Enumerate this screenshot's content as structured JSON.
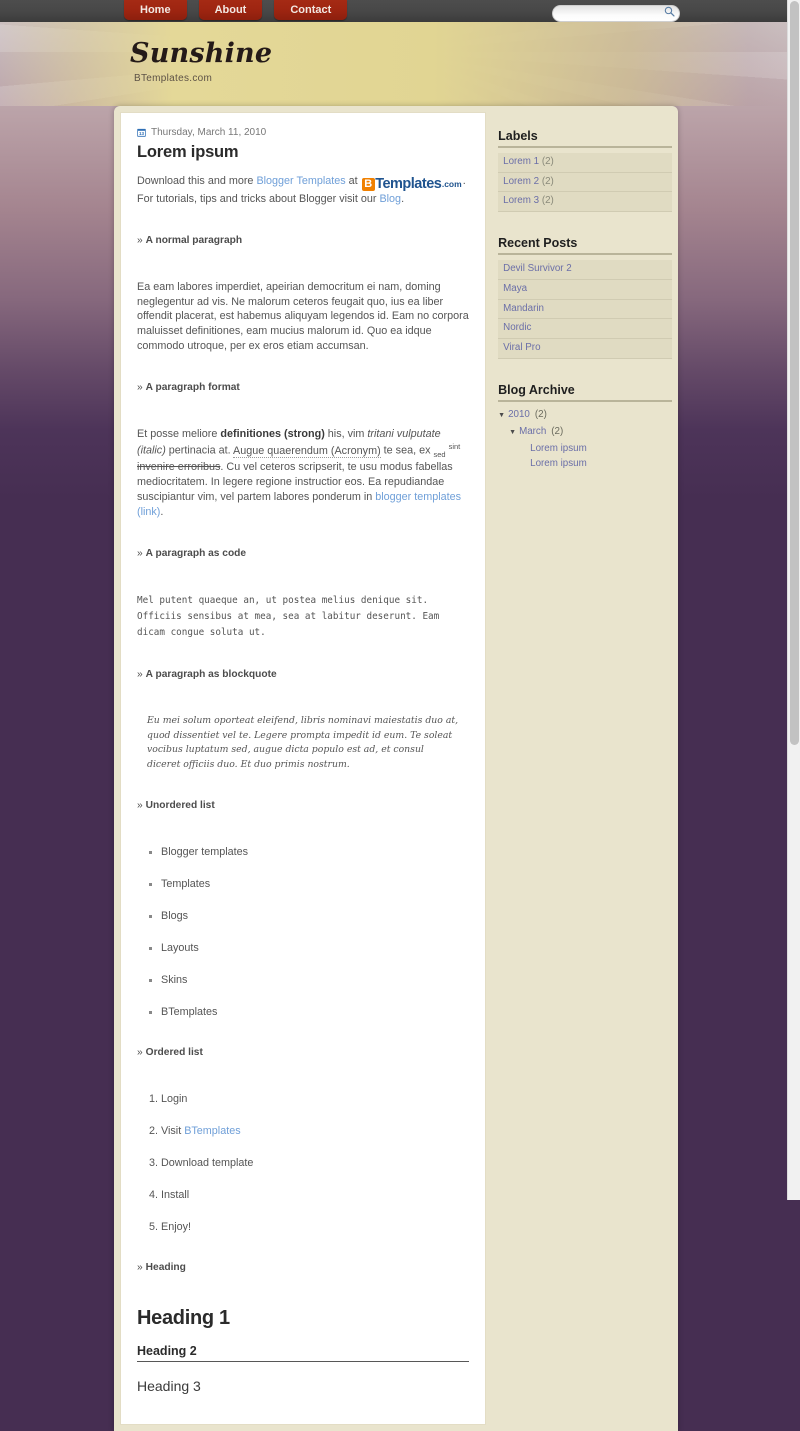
{
  "topbar": {
    "nav_items": [
      {
        "label": "Home"
      },
      {
        "label": "About"
      },
      {
        "label": "Contact"
      }
    ],
    "search": {
      "value": "",
      "placeholder": "",
      "icon": "search-icon"
    }
  },
  "header": {
    "site_title": "Sunshine",
    "site_subtitle": "BTemplates.com"
  },
  "post": {
    "date_icon": "calendar-icon",
    "date": "Thursday, March 11, 2010",
    "title": "Lorem ipsum",
    "intro": {
      "t1": "Download this and more ",
      "link1": "Blogger Templates",
      "t2": " at ",
      "logo_b": "B",
      "logo_word": "Templates",
      "logo_com": ".com",
      "t3": ". For tutorials, tips and tricks about Blogger visit our ",
      "link2": "Blog",
      "t4": "."
    },
    "sections": {
      "normal_paragraph": {
        "label": "A normal paragraph",
        "text": "Ea eam labores imperdiet, apeirian democritum ei nam, doming neglegentur ad vis. Ne malorum ceteros feugait quo, ius ea liber offendit placerat, est habemus aliquyam legendos id. Eam no corpora maluisset definitiones, eam mucius malorum id. Quo ea idque commodo utroque, per ex eros etiam accumsan."
      },
      "paragraph_format": {
        "label": "A paragraph format",
        "p1": "Et posse meliore ",
        "strong": "definitiones (strong)",
        "p2": " his, vim ",
        "italic": "tritani vulputate (italic)",
        "p3": " pertinacia at. ",
        "acronym": "Augue quaerendum (Acronym)",
        "p4": " te sea, ex ",
        "sub": "sed",
        "p5": " ",
        "sup": "sint",
        "p6": " ",
        "strike": "invenire erroribus",
        "p7": ". Cu vel ceteros scripserit, te usu modus fabellas mediocritatem. In legere regione instructior eos. Ea repudiandae suscipiantur vim, vel partem labores ponderum in ",
        "link": "blogger templates (link)",
        "p8": "."
      },
      "code": {
        "label": "A paragraph as code",
        "text": "Mel putent quaeque an, ut postea melius denique sit. Officiis sensibus at mea, sea at labitur deserunt. Eam dicam congue soluta ut."
      },
      "blockquote": {
        "label": "A paragraph as blockquote",
        "text": "Eu mei solum oporteat eleifend, libris nominavi maiestatis duo at, quod dissentiet vel te. Legere prompta impedit id eum. Te soleat vocibus luptatum sed, augue dicta populo est ad, et consul diceret officiis duo. Et duo primis nostrum."
      },
      "unordered_list": {
        "label": "Unordered list",
        "items": [
          "Blogger templates",
          "Templates",
          "Blogs",
          "Layouts",
          "Skins",
          "BTemplates"
        ]
      },
      "ordered_list": {
        "label": "Ordered list",
        "items": [
          {
            "text": "Login",
            "link": ""
          },
          {
            "text": "Visit ",
            "link": "BTemplates"
          },
          {
            "text": "Download template",
            "link": ""
          },
          {
            "text": "Install",
            "link": ""
          },
          {
            "text": "Enjoy!",
            "link": ""
          }
        ]
      },
      "headings": {
        "label": "Heading",
        "h1": "Heading 1",
        "h2": "Heading 2",
        "h3": "Heading 3"
      }
    }
  },
  "sidebar": {
    "labels": {
      "title": "Labels",
      "items": [
        {
          "label": "Lorem 1",
          "count": "(2)"
        },
        {
          "label": "Lorem 2",
          "count": "(2)"
        },
        {
          "label": "Lorem 3",
          "count": "(2)"
        }
      ]
    },
    "recent_posts": {
      "title": "Recent Posts",
      "items": [
        {
          "label": "Devil Survivor 2"
        },
        {
          "label": "Maya"
        },
        {
          "label": "Mandarin"
        },
        {
          "label": "Nordic"
        },
        {
          "label": "Viral Pro"
        }
      ]
    },
    "blog_archive": {
      "title": "Blog Archive",
      "year": {
        "triangle": "▼",
        "label": "2010",
        "count": "(2)"
      },
      "month": {
        "triangle": "▼",
        "label": "March",
        "count": "(2)"
      },
      "posts": [
        {
          "label": "Lorem ipsum"
        },
        {
          "label": "Lorem ipsum"
        }
      ]
    }
  },
  "colors": {
    "nav_red": "#9e2511",
    "topbar_gray": "#474747",
    "header_gold": "#e1d593",
    "page_purple": "#462e52",
    "wrapper_cream": "#e9e4cd",
    "sidebar_item": "#e0dbc2",
    "link_blue": "#6f9fd8",
    "sidebar_link": "#6b6fa8",
    "logo_orange": "#f08000",
    "logo_blue": "#20548f"
  }
}
